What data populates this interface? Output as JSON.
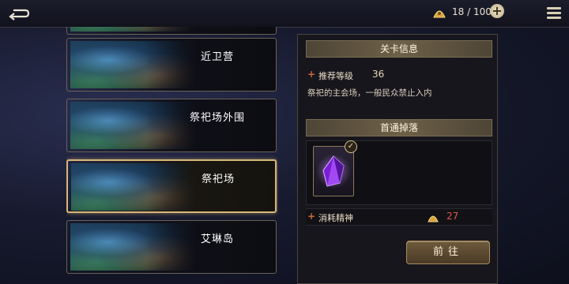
{
  "topbar": {
    "energy": "18 / 100",
    "plus_label": "+"
  },
  "stages": [
    {
      "name": ""
    },
    {
      "name": "近卫营"
    },
    {
      "name": "祭祀场外围"
    },
    {
      "name": "祭祀场",
      "selected": true
    },
    {
      "name": "艾琳岛"
    }
  ],
  "panel": {
    "info_title": "关卡信息",
    "recommended_level_label": "推荐等级",
    "recommended_level_value": "36",
    "description": "祭祀的主会场，一般民众禁止入内",
    "first_clear_title": "首通掉落",
    "check_mark": "✓",
    "cost_label": "消耗精神",
    "cost_value": "27",
    "go_button": "前往"
  },
  "colors": {
    "accent_gold": "#d8b778",
    "cost_red": "#c9683a",
    "crystal_purple": "#9b3cf0"
  }
}
